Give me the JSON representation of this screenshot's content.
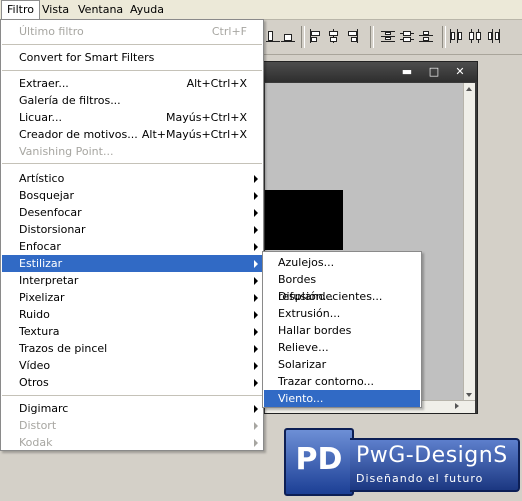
{
  "menubar": {
    "items": [
      {
        "label": "Filtro"
      },
      {
        "label": "Vista"
      },
      {
        "label": "Ventana"
      },
      {
        "label": "Ayuda"
      }
    ]
  },
  "filter_menu": {
    "last_filter": {
      "label": "Último filtro",
      "shortcut": "Ctrl+F"
    },
    "convert_smart": {
      "label": "Convert for Smart Filters"
    },
    "extract": {
      "label": "Extraer...",
      "shortcut": "Alt+Ctrl+X"
    },
    "gallery": {
      "label": "Galería de filtros..."
    },
    "liquify": {
      "label": "Licuar...",
      "shortcut": "Mayús+Ctrl+X"
    },
    "pattern_maker": {
      "label": "Creador de motivos...",
      "shortcut": "Alt+Mayús+Ctrl+X"
    },
    "vanishing_point": {
      "label": "Vanishing Point..."
    },
    "categories": [
      {
        "label": "Artístico"
      },
      {
        "label": "Bosquejar"
      },
      {
        "label": "Desenfocar"
      },
      {
        "label": "Distorsionar"
      },
      {
        "label": "Enfocar"
      },
      {
        "label": "Estilizar"
      },
      {
        "label": "Interpretar"
      },
      {
        "label": "Pixelizar"
      },
      {
        "label": "Ruido"
      },
      {
        "label": "Textura"
      },
      {
        "label": "Trazos de pincel"
      },
      {
        "label": "Vídeo"
      },
      {
        "label": "Otros"
      }
    ],
    "plugins": [
      {
        "label": "Digimarc"
      },
      {
        "label": "Distort"
      },
      {
        "label": "Kodak"
      }
    ]
  },
  "stylize_submenu": {
    "items": [
      {
        "label": "Azulejos..."
      },
      {
        "label": "Bordes resplandecientes..."
      },
      {
        "label": "Difusión..."
      },
      {
        "label": "Extrusión..."
      },
      {
        "label": "Hallar bordes"
      },
      {
        "label": "Relieve..."
      },
      {
        "label": "Solarizar"
      },
      {
        "label": "Trazar contorno..."
      },
      {
        "label": "Viento..."
      }
    ]
  },
  "document_window": {
    "minimize_glyph": "▬",
    "maximize_glyph": "□",
    "close_glyph": "✕"
  },
  "watermark": {
    "badge": "PD",
    "brand": "PwG-DesignS",
    "tagline": "Diseñando el futuro"
  },
  "colors": {
    "highlight": "#316ac5",
    "disabled_text": "#a7a6a1"
  }
}
